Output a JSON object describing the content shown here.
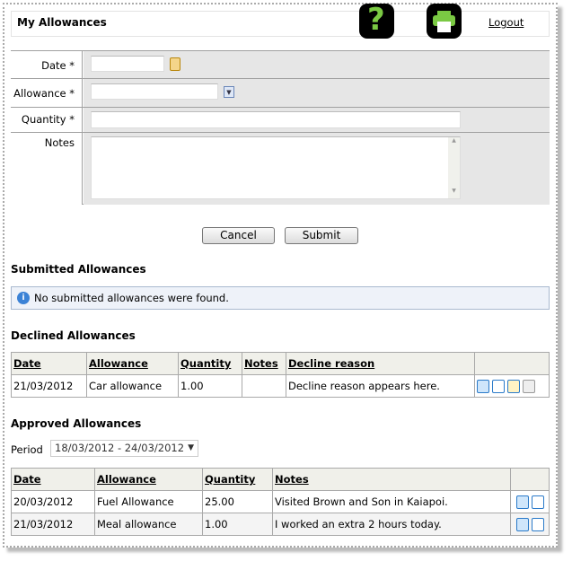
{
  "header": {
    "title": "My Allowances",
    "help_icon": "help-question-icon",
    "print_icon": "printer-icon",
    "logout": "Logout"
  },
  "form": {
    "date_label": "Date *",
    "allowance_label": "Allowance *",
    "quantity_label": "Quantity *",
    "notes_label": "Notes",
    "date_value": "",
    "allowance_value": "",
    "quantity_value": "",
    "notes_value": "",
    "cancel": "Cancel",
    "submit": "Submit"
  },
  "submitted": {
    "heading": "Submitted Allowances",
    "message": "No submitted allowances were found."
  },
  "declined": {
    "heading": "Declined Allowances",
    "columns": [
      "Date",
      "Allowance",
      "Quantity",
      "Notes",
      "Decline reason"
    ],
    "rows": [
      {
        "date": "21/03/2012",
        "allowance": "Car allowance",
        "quantity": "1.00",
        "notes": "",
        "reason": "Decline reason appears here."
      }
    ]
  },
  "approved": {
    "heading": "Approved Allowances",
    "period_label": "Period",
    "period_value": "18/03/2012 - 24/03/2012",
    "columns": [
      "Date",
      "Allowance",
      "Quantity",
      "Notes"
    ],
    "rows": [
      {
        "date": "20/03/2012",
        "allowance": "Fuel Allowance",
        "quantity": "25.00",
        "notes": "Visited Brown and Son in Kaiapoi."
      },
      {
        "date": "21/03/2012",
        "allowance": "Meal allowance",
        "quantity": "1.00",
        "notes": "I worked an extra 2 hours today."
      }
    ]
  }
}
